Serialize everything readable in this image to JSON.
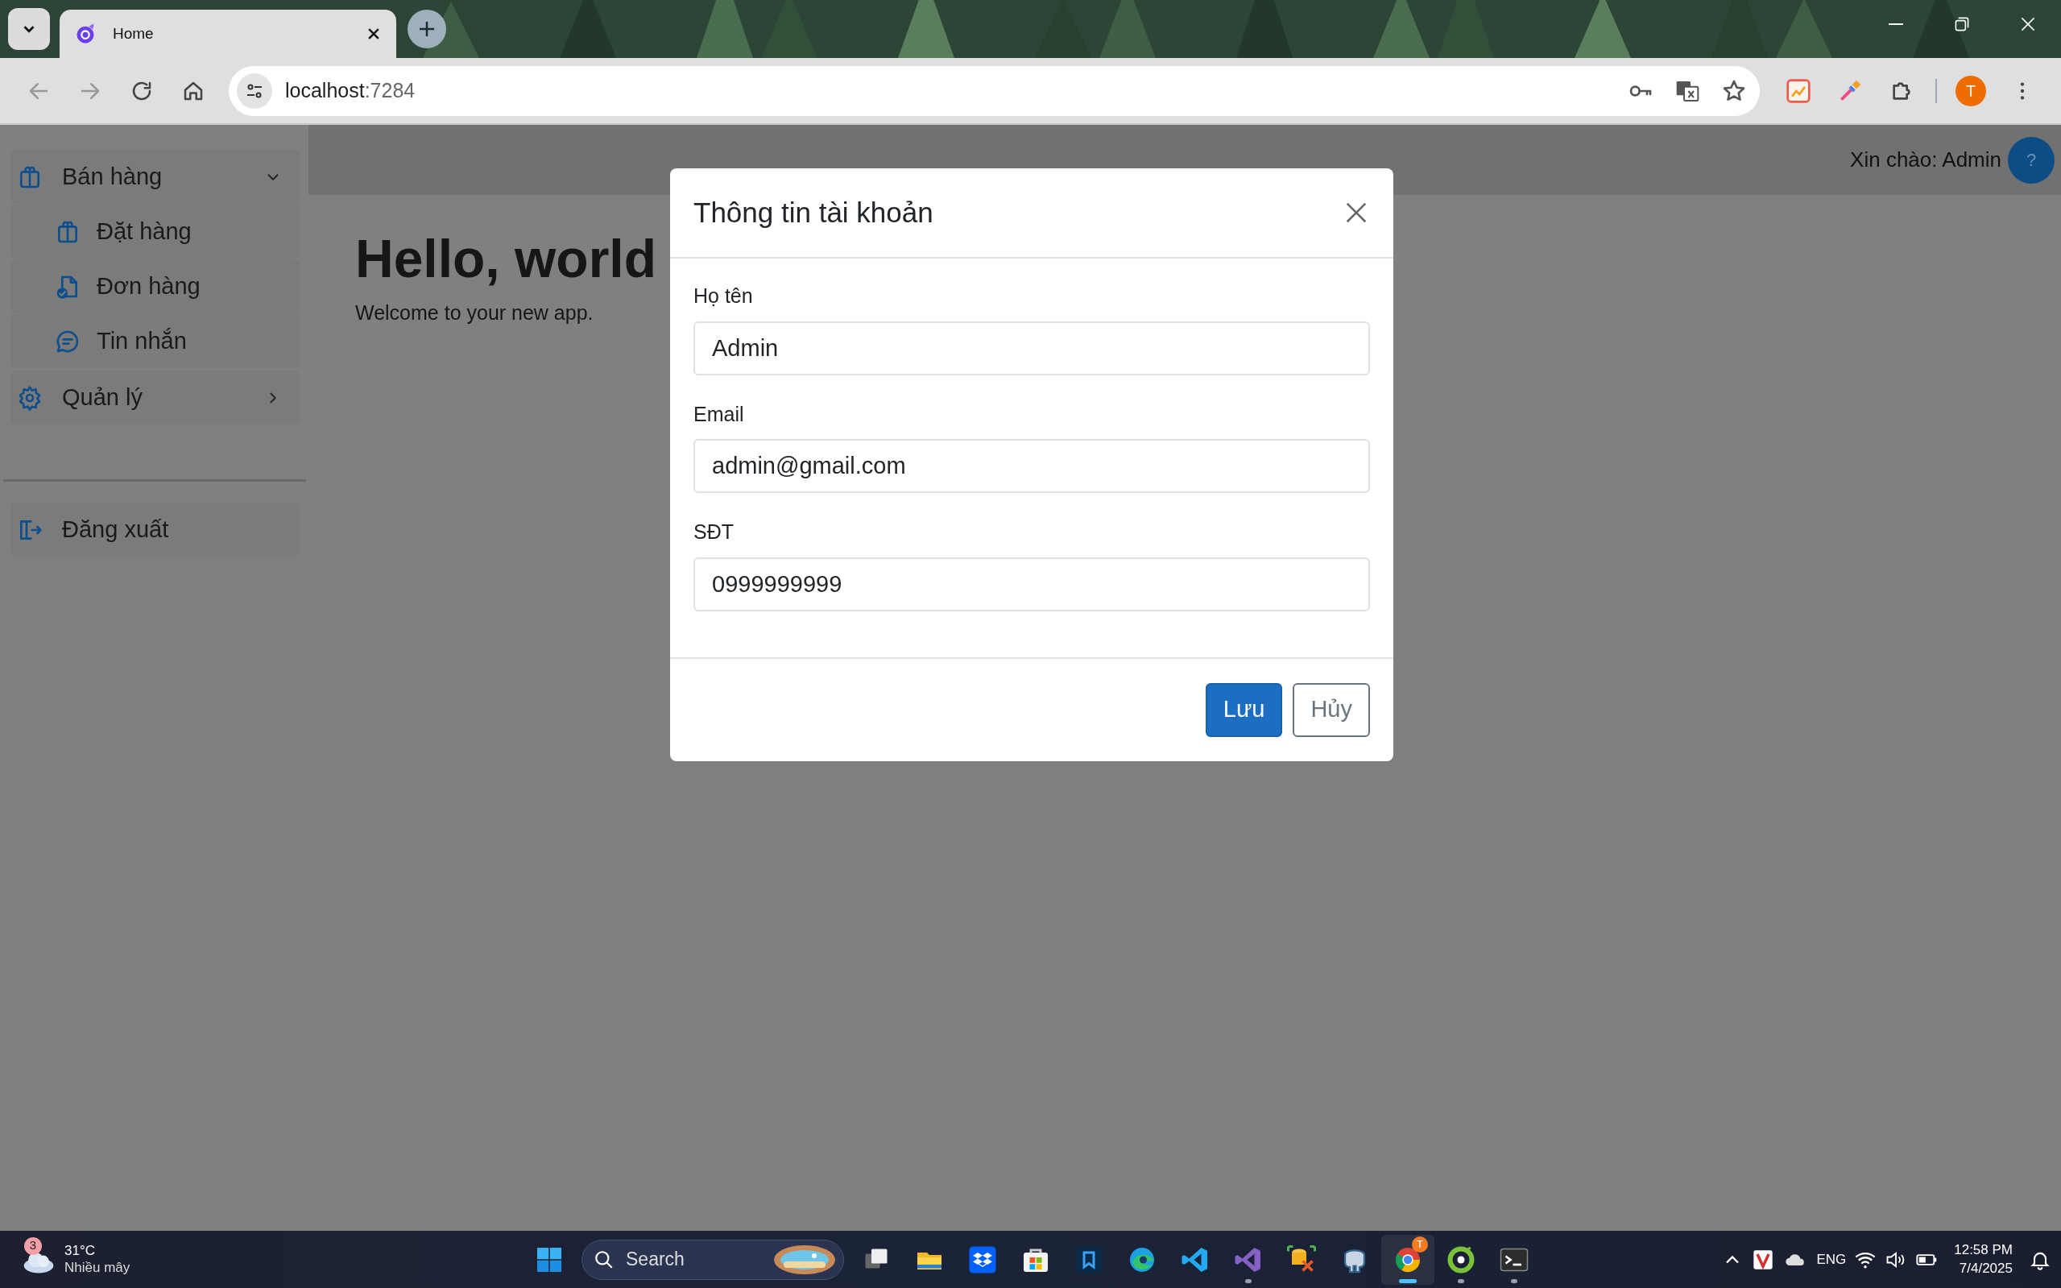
{
  "browser": {
    "tab": {
      "title": "Home",
      "selected": true
    },
    "address": {
      "host": "localhost",
      "port": ":7284"
    },
    "profile_initial": "T"
  },
  "header": {
    "greeting": "Xin chào: Admin",
    "help": "?"
  },
  "sidebar": {
    "items": [
      {
        "label": "Bán hàng",
        "kind": "bag",
        "expanded": true,
        "children": [
          {
            "label": "Đặt hàng",
            "kind": "bag"
          },
          {
            "label": "Đơn hàng",
            "kind": "doc"
          },
          {
            "label": "Tin nhắn",
            "kind": "chat"
          }
        ]
      },
      {
        "label": "Quản lý",
        "kind": "gear",
        "expanded": false
      }
    ],
    "footer_items": [
      {
        "label": "Đăng xuất",
        "kind": "logout"
      }
    ]
  },
  "content": {
    "heading": "Hello, world",
    "text": "Welcome to your new app."
  },
  "modal": {
    "title": "Thông tin tài khoản",
    "fields": [
      {
        "label": "Họ tên",
        "value": "Admin"
      },
      {
        "label": "Email",
        "value": "admin@gmail.com"
      },
      {
        "label": "SĐT",
        "value": "0999999999"
      }
    ],
    "buttons": [
      {
        "label": "Lưu",
        "kind": "primary"
      },
      {
        "label": "Hủy",
        "kind": "secondary"
      }
    ]
  },
  "taskbar": {
    "weather": {
      "badge": "3",
      "temperature": "31°C",
      "condition": "Nhiều mây"
    },
    "search": {
      "placeholder": "Search"
    },
    "apps": [
      {
        "kind": "taskview",
        "running": false,
        "selected": false
      },
      {
        "kind": "explorer",
        "running": false,
        "selected": false
      },
      {
        "kind": "dropbox",
        "running": false,
        "selected": false
      },
      {
        "kind": "store",
        "running": false,
        "selected": false
      },
      {
        "kind": "bluebox",
        "running": false,
        "selected": false
      },
      {
        "kind": "edge",
        "running": false,
        "selected": false
      },
      {
        "kind": "vscode",
        "running": false,
        "selected": false
      },
      {
        "kind": "vstudio",
        "running": true,
        "selected": false
      },
      {
        "kind": "dbtool",
        "running": false,
        "selected": false
      },
      {
        "kind": "elephant",
        "running": false,
        "selected": false
      },
      {
        "kind": "chrome",
        "running": true,
        "selected": true,
        "badge": "T"
      },
      {
        "kind": "greenring",
        "running": true,
        "selected": false
      },
      {
        "kind": "terminal",
        "running": true,
        "selected": false
      }
    ],
    "tray": {
      "language": "ENG",
      "time": "12:58 PM",
      "date": "7/4/2025"
    }
  }
}
